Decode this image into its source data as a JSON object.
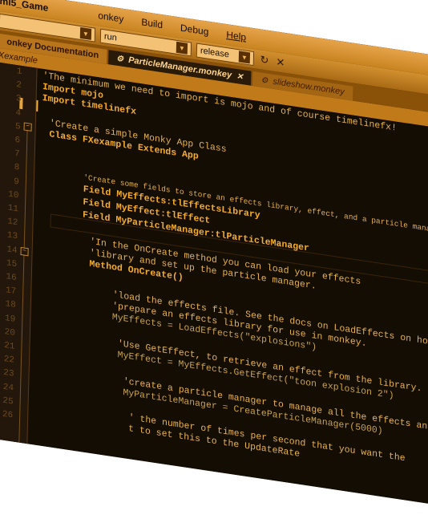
{
  "title_fragment": "ml5_Game",
  "menu": {
    "items": [
      "onkey",
      "Build",
      "Debug",
      "Help"
    ]
  },
  "toolbar": {
    "target_value": "run",
    "config_value": "release"
  },
  "tabs": {
    "doc_label": "onkey Documentation",
    "active_label": "ParticleManager.monkey",
    "other_label": "slideshow.monkey"
  },
  "file_label": "Xexample",
  "code": {
    "line_numbers": [
      "1",
      "2",
      "3",
      "4",
      "5",
      "6",
      "7",
      "8",
      "9",
      "10",
      "11",
      "12",
      "13",
      "14",
      "15",
      "16",
      "17",
      "18",
      "19",
      "20",
      "21",
      "22",
      "23",
      "24",
      "25",
      "26"
    ],
    "l1": "'The minimum we need to import is mojo and of course timelinefx!",
    "l2": "Import mojo",
    "l3": "Import timelinefx",
    "l5": "'Create a simple Monky App Class",
    "l6": "Class FXexample Extends App",
    "l9": "'Create some fields to store an effects library, effect, and a particle manager",
    "l10": "Field MyEffects:tlEffectsLibrary",
    "l11": "Field MyEffect:tlEffect",
    "l12": "Field MyParticleManager:tlParticleManager",
    "l14": "'In the OnCreate method you can load your effects",
    "l15": "'library and set up the particle manager.",
    "l16": "Method OnCreate()",
    "l18": "'load the effects file. See the docs on LoadEffects on how to",
    "l19": "'prepare an effects library for use in monkey.",
    "l20": "MyEffects = LoadEffects(\"explosions\")",
    "l22": "'Use GetEffect, to retrieve an effect from the library.",
    "l23": "MyEffect = MyEffects.GetEffect(\"toon explosion 2\")",
    "l25": "'create a particle manager to manage all the effects and",
    "l26": "MyParticleManager = CreateParticleManager(5000)",
    "l27": "' the number of times per second that you want the",
    "l28": "t to set this to the UpdateRate"
  }
}
